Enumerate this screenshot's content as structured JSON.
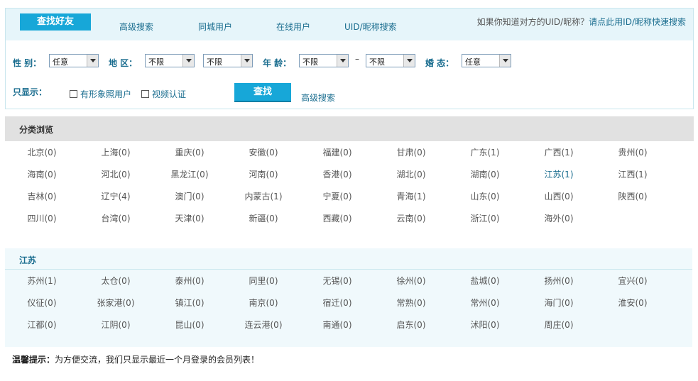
{
  "tabs": [
    "查找好友",
    "高级搜索",
    "同城用户",
    "在线用户",
    "UID/昵称搜索"
  ],
  "tab_hint": {
    "text": "如果你知道对方的UID/昵称？",
    "link": "请点此用ID/昵称快速搜索"
  },
  "form": {
    "gender_label": "性 别：",
    "gender_value": "任意",
    "region_label": "地 区：",
    "region1_value": "不限",
    "region2_value": "不限",
    "age_label": "年 龄：",
    "age_from_value": "不限",
    "age_dash": "–",
    "age_to_value": "不限",
    "marital_label": "婚 态：",
    "marital_value": "任意",
    "show_only_label": "只显示：",
    "photo_checkbox_label": "有形象照用户",
    "video_checkbox_label": "视频认证",
    "find_button": "查找",
    "advanced_link": "高级搜索"
  },
  "browse": {
    "title": "分类浏览",
    "regions": [
      "北京(0)",
      "上海(0)",
      "重庆(0)",
      "安徽(0)",
      "福建(0)",
      "甘肃(0)",
      "广东(1)",
      "广西(1)",
      "贵州(0)",
      "海南(0)",
      "河北(0)",
      "黑龙江(0)",
      "河南(0)",
      "香港(0)",
      "湖北(0)",
      "湖南(0)",
      "江苏(1)",
      "江西(1)",
      "吉林(0)",
      "辽宁(4)",
      "澳门(0)",
      "内蒙古(1)",
      "宁夏(0)",
      "青海(1)",
      "山东(0)",
      "山西(0)",
      "陕西(0)",
      "四川(0)",
      "台湾(0)",
      "天津(0)",
      "新疆(0)",
      "西藏(0)",
      "云南(0)",
      "浙江(0)",
      "海外(0)"
    ]
  },
  "province": {
    "title": "江苏",
    "cities": [
      "苏州(1)",
      "太仓(0)",
      "泰州(0)",
      "同里(0)",
      "无锡(0)",
      "徐州(0)",
      "盐城(0)",
      "扬州(0)",
      "宜兴(0)",
      "仪征(0)",
      "张家港(0)",
      "镇江(0)",
      "南京(0)",
      "宿迁(0)",
      "常熟(0)",
      "常州(0)",
      "海门(0)",
      "淮安(0)",
      "江都(0)",
      "江阴(0)",
      "昆山(0)",
      "连云港(0)",
      "南通(0)",
      "启东(0)",
      "沭阳(0)",
      "周庄(0)"
    ]
  },
  "tip": {
    "label": "温馨提示：",
    "text": "为方便交流，我们只显示最近一个月登录的会员列表！"
  },
  "colors": {
    "accent": "#17a7d8",
    "link": "#1a6d8f"
  }
}
